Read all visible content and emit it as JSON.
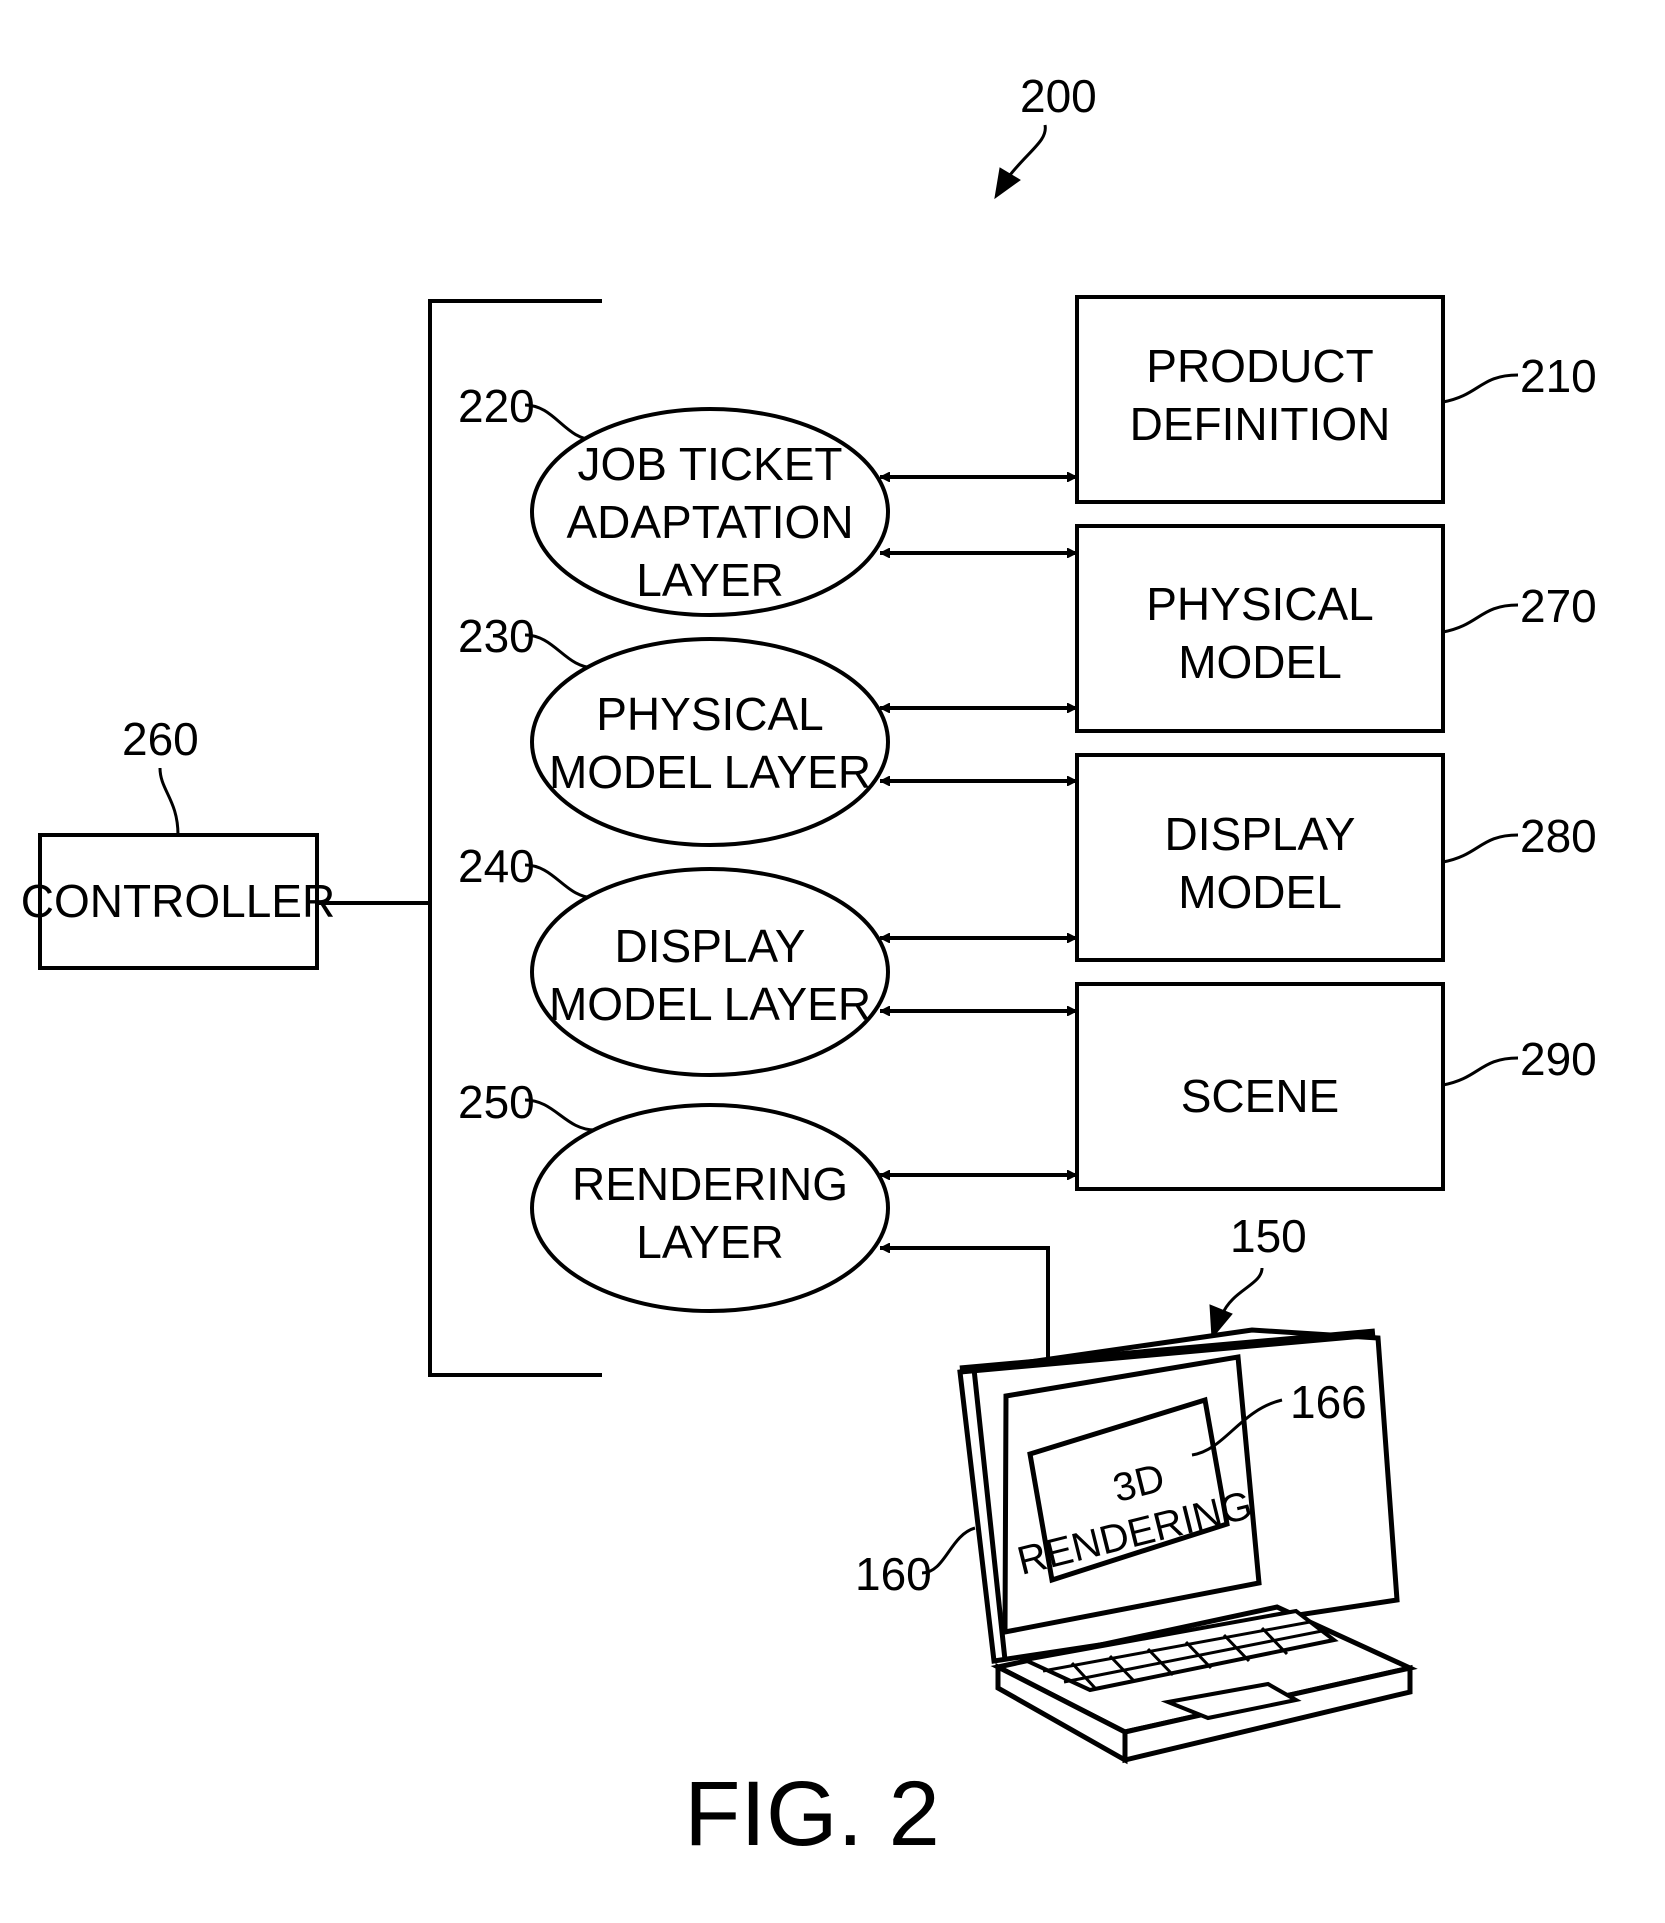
{
  "figure": {
    "caption": "FIG. 2",
    "system_ref": "200"
  },
  "controller": {
    "ref": "260",
    "label": "CONTROLLER"
  },
  "layers": [
    {
      "ref": "220",
      "lines": [
        "JOB TICKET",
        "ADAPTATION",
        "LAYER"
      ]
    },
    {
      "ref": "230",
      "lines": [
        "PHYSICAL",
        "MODEL LAYER"
      ]
    },
    {
      "ref": "240",
      "lines": [
        "DISPLAY",
        "MODEL LAYER"
      ]
    },
    {
      "ref": "250",
      "lines": [
        "RENDERING",
        "LAYER"
      ]
    }
  ],
  "models": [
    {
      "ref": "210",
      "lines": [
        "PRODUCT",
        "DEFINITION"
      ]
    },
    {
      "ref": "270",
      "lines": [
        "PHYSICAL",
        "MODEL"
      ]
    },
    {
      "ref": "280",
      "lines": [
        "DISPLAY",
        "MODEL"
      ]
    },
    {
      "ref": "290",
      "lines": [
        "SCENE"
      ]
    }
  ],
  "device": {
    "ref": "150",
    "display_ref": "160",
    "rendering_ref": "166",
    "rendering_lines": [
      "3D",
      "RENDERING"
    ]
  }
}
